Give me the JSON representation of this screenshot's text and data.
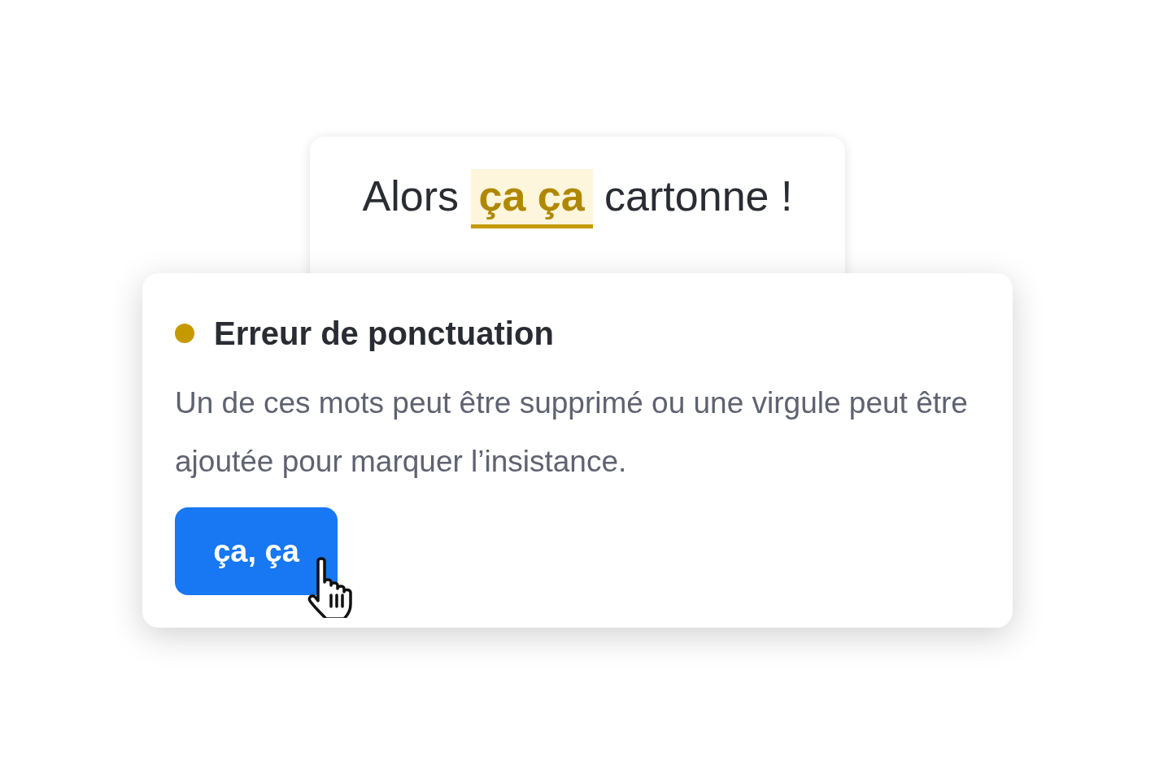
{
  "sentence": {
    "before": "Alors",
    "flagged": "ça ça",
    "after": "cartonne !"
  },
  "issue": {
    "title": "Erreur de ponctuation",
    "color": "#c59a00",
    "message": "Un de ces mots peut être supprimé ou une virgule peut être ajoutée pour marquer l’insistance.",
    "suggestion": "ça, ça"
  }
}
